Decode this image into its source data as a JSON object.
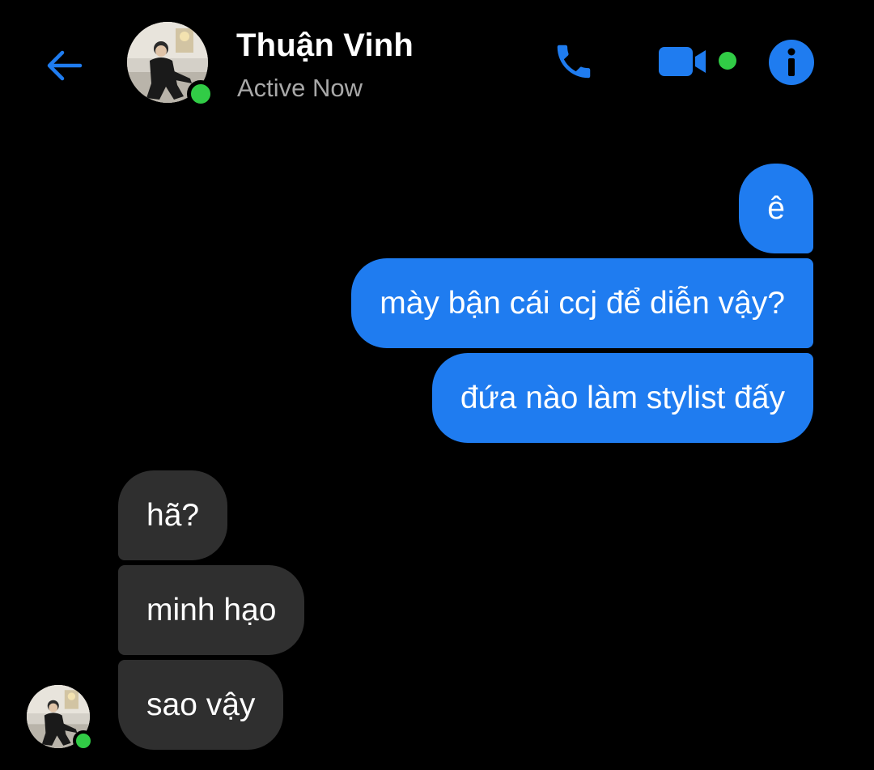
{
  "header": {
    "contact_name": "Thuận Vinh",
    "status": "Active Now",
    "back_icon": "back-arrow-icon",
    "call_icon": "phone-icon",
    "video_icon": "video-camera-icon",
    "info_icon": "info-icon"
  },
  "colors": {
    "background": "#000000",
    "accent": "#1f7cf0",
    "outgoing_bubble": "#1f7cf0",
    "incoming_bubble": "#2f2f2f",
    "presence": "#31cc46",
    "secondary_text": "#a8a8a8"
  },
  "messages": [
    {
      "direction": "outgoing",
      "text": "ê"
    },
    {
      "direction": "outgoing",
      "text": "mày bận cái ccj để diễn vậy?"
    },
    {
      "direction": "outgoing",
      "text": "đứa nào làm stylist đấy"
    },
    {
      "direction": "incoming",
      "text": "hã?"
    },
    {
      "direction": "incoming",
      "text": "minh hạo"
    },
    {
      "direction": "incoming",
      "text": "sao vậy"
    }
  ]
}
